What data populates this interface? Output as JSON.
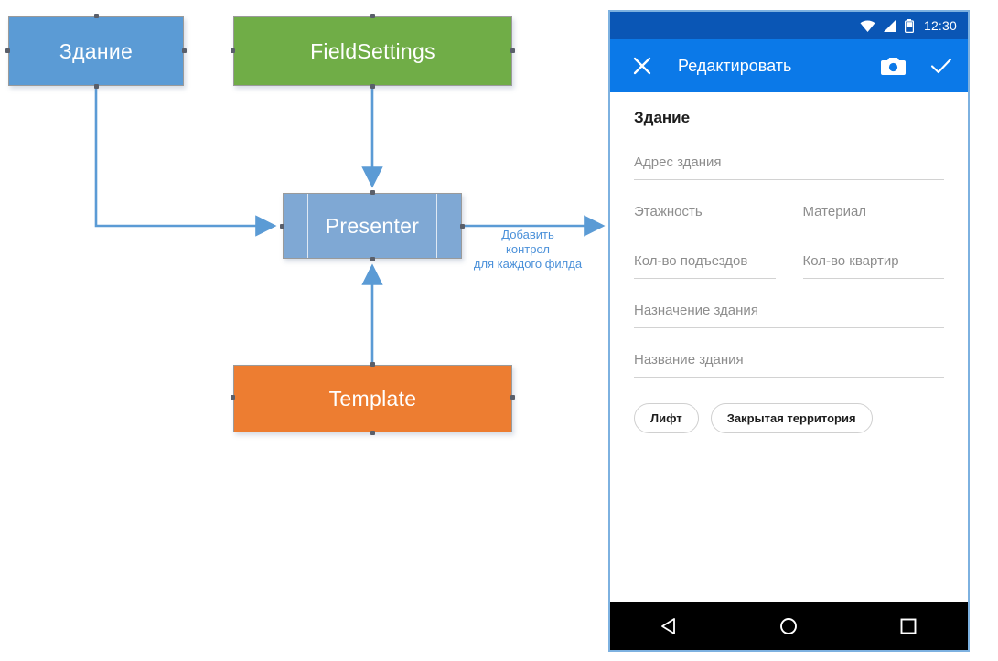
{
  "diagram": {
    "nodes": [
      {
        "id": "zdanie",
        "label": "Здание",
        "color": "#5B9BD5"
      },
      {
        "id": "fieldsettings",
        "label": "FieldSettings",
        "color": "#70AD47"
      },
      {
        "id": "presenter",
        "label": "Presenter",
        "color": "#7FA8D4"
      },
      {
        "id": "template",
        "label": "Template",
        "color": "#ED7D31"
      }
    ],
    "annotation": {
      "line1": "Добавить",
      "line2": "контрол",
      "line3": "для каждого филда",
      "color": "#4A90D9"
    },
    "connector_color": "#5B9BD5"
  },
  "phone": {
    "statusbar": {
      "wifi_icon": "wifi-icon",
      "signal_icon": "signal-icon",
      "battery_icon": "battery-icon",
      "time": "12:30",
      "background": "#0A56B5"
    },
    "appbar": {
      "close_icon": "close-icon",
      "title": "Редактировать",
      "camera_icon": "camera-icon",
      "confirm_icon": "check-icon",
      "background": "#0B79E8"
    },
    "form": {
      "title": "Здание",
      "rows": [
        {
          "fields": [
            {
              "label": "Адрес здания"
            }
          ]
        },
        {
          "fields": [
            {
              "label": "Этажность"
            },
            {
              "label": "Материал"
            }
          ]
        },
        {
          "fields": [
            {
              "label": "Кол-во подъездов"
            },
            {
              "label": "Кол-во квартир"
            }
          ]
        },
        {
          "fields": [
            {
              "label": "Назначение здания"
            }
          ]
        },
        {
          "fields": [
            {
              "label": "Название здания"
            }
          ]
        }
      ],
      "chips": [
        {
          "label": "Лифт"
        },
        {
          "label": "Закрытая территория"
        }
      ]
    },
    "navbar": {
      "back_icon": "back-triangle-icon",
      "home_icon": "home-circle-icon",
      "recents_icon": "recents-square-icon",
      "background": "#000000"
    }
  }
}
